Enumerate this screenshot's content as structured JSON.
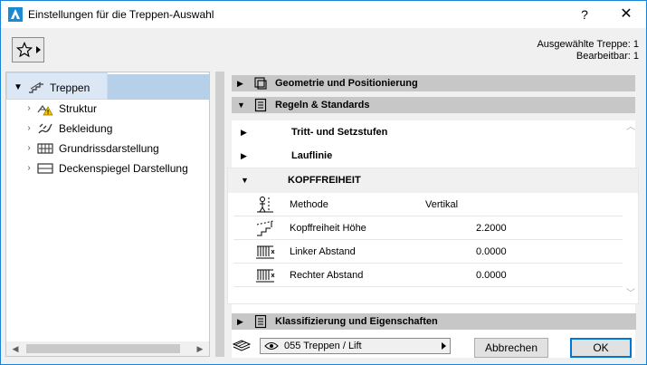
{
  "window": {
    "title": "Einstellungen für die Treppen-Auswahl",
    "help_label": "?",
    "close_label": "✕"
  },
  "selection_info": {
    "line1": "Ausgewählte Treppe: 1",
    "line2": "Bearbeitbar: 1"
  },
  "tree": {
    "items": [
      {
        "label": "Treppen",
        "icon": "stair-icon",
        "expanded": true,
        "selected": true
      },
      {
        "label": "Struktur",
        "icon": "structure-warning-icon"
      },
      {
        "label": "Bekleidung",
        "icon": "cladding-icon"
      },
      {
        "label": "Grundrissdarstellung",
        "icon": "floorplan-icon"
      },
      {
        "label": "Deckenspiegel Darstellung",
        "icon": "ceiling-plan-icon"
      }
    ]
  },
  "sections": {
    "geometrie": {
      "label": "Geometrie und Positionierung",
      "expanded": false
    },
    "regeln": {
      "label": "Regeln & Standards",
      "expanded": true
    },
    "klassifizierung": {
      "label": "Klassifizierung und Eigenschaften",
      "expanded": false
    }
  },
  "subsections": [
    {
      "label": "Tritt- und Setzstufen",
      "expanded": false
    },
    {
      "label": "Lauflinie",
      "expanded": false
    },
    {
      "label": "KOPFFREIHEIT",
      "expanded": true
    }
  ],
  "kopffreiheit": {
    "params": [
      {
        "name": "Methode",
        "value": "Vertikal",
        "icon": "method-icon"
      },
      {
        "name": "Kopffreiheit Höhe",
        "value": "2.2000",
        "icon": "headroom-height-icon"
      },
      {
        "name": "Linker Abstand",
        "value": "0.0000",
        "icon": "left-clearance-icon"
      },
      {
        "name": "Rechter Abstand",
        "value": "0.0000",
        "icon": "right-clearance-icon"
      }
    ]
  },
  "layer": {
    "value": "055 Treppen / Lift"
  },
  "buttons": {
    "cancel": "Abbrechen",
    "ok": "OK"
  },
  "colors": {
    "accent": "#0078d7",
    "selection": "#b7d0ea",
    "section_bar": "#c7c7c7"
  }
}
